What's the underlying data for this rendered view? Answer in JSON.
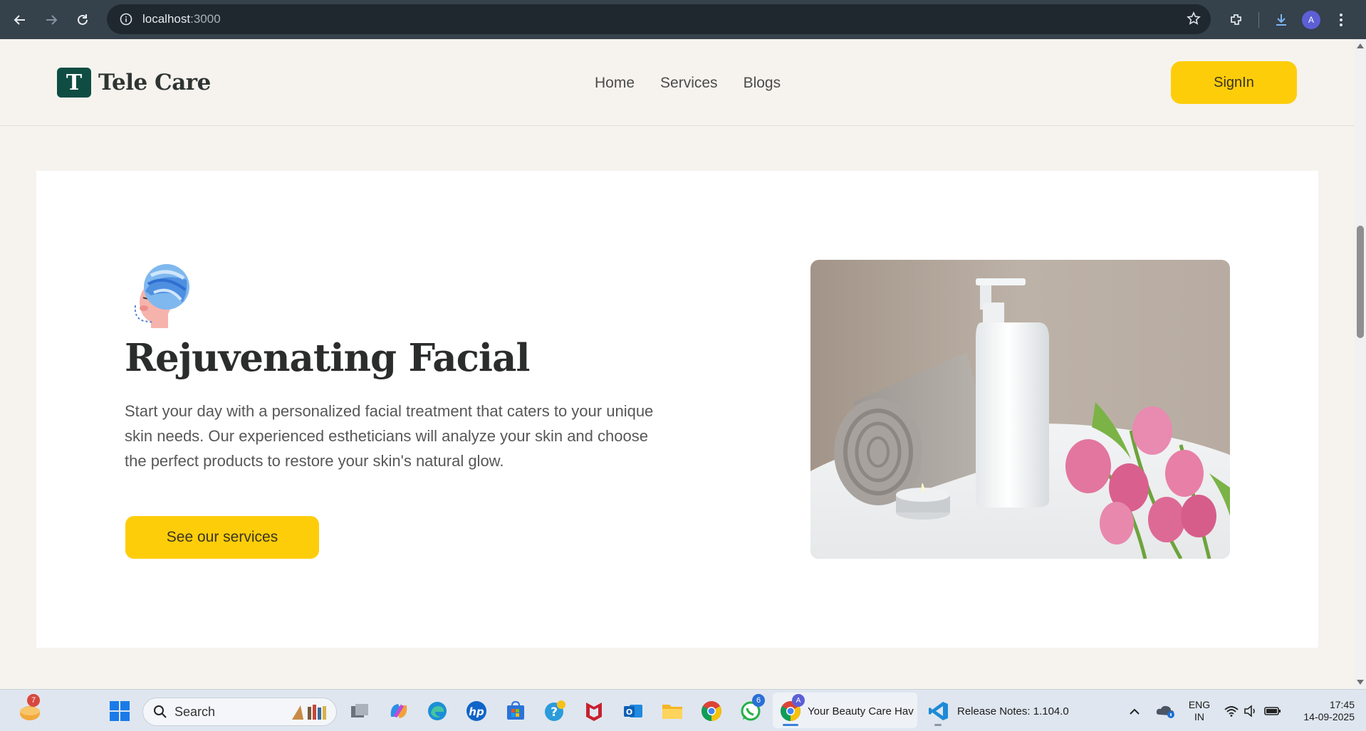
{
  "browser": {
    "url_host": "localhost",
    "url_port": ":3000",
    "profile_initial": "A"
  },
  "site": {
    "brand_letter": "T",
    "brand_name": "Tele Care",
    "nav": [
      {
        "label": "Home"
      },
      {
        "label": "Services"
      },
      {
        "label": "Blogs"
      }
    ],
    "signin_label": "SignIn"
  },
  "hero": {
    "title": "Rejuvenating Facial",
    "description": "Start your day with a personalized facial treatment that caters to your unique skin needs. Our experienced estheticians will analyze your skin and choose the perfect products to restore your skin's natural glow.",
    "cta_label": "See our services"
  },
  "taskbar": {
    "widgets_badge": "7",
    "search_placeholder": "Search",
    "whatsapp_badge": "6",
    "chrome_profile_badge": "A",
    "chrome_window_title": "Your Beauty Care Hav",
    "vscode_window_title": "Release Notes: 1.104.0",
    "lang_top": "ENG",
    "lang_bottom": "IN",
    "time": "17:45",
    "date": "14-09-2025"
  },
  "colors": {
    "accent_yellow": "#fecd0a",
    "brand_green": "#0f4d43",
    "page_bg": "#f6f3ee",
    "chrome_bg": "#35414b"
  }
}
